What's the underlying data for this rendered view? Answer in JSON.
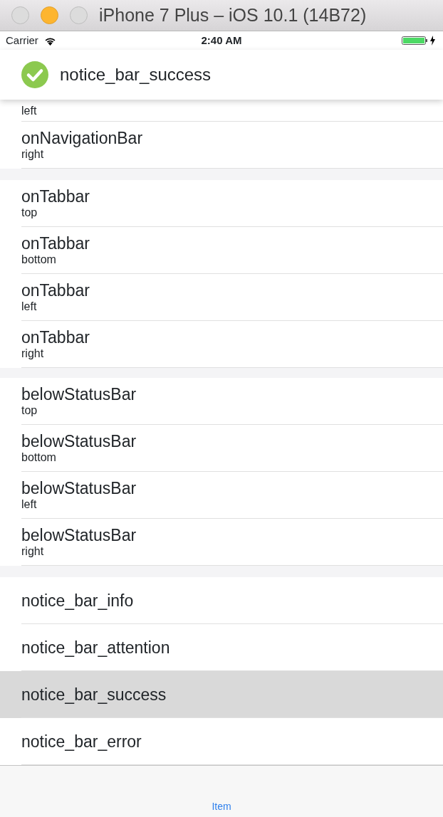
{
  "window": {
    "title": "iPhone 7 Plus – iOS 10.1 (14B72)"
  },
  "status_bar": {
    "carrier": "Carrier",
    "time": "2:40 AM"
  },
  "notice": {
    "kind": "success",
    "title": "notice_bar_success"
  },
  "sections": [
    {
      "rows": [
        {
          "subtitle": "left",
          "selected": false
        },
        {
          "title": "onNavigationBar",
          "subtitle": "right",
          "selected": false
        }
      ]
    },
    {
      "rows": [
        {
          "title": "onTabbar",
          "subtitle": "top",
          "selected": false
        },
        {
          "title": "onTabbar",
          "subtitle": "bottom",
          "selected": false
        },
        {
          "title": "onTabbar",
          "subtitle": "left",
          "selected": false
        },
        {
          "title": "onTabbar",
          "subtitle": "right",
          "selected": false
        }
      ]
    },
    {
      "rows": [
        {
          "title": "belowStatusBar",
          "subtitle": "top",
          "selected": false
        },
        {
          "title": "belowStatusBar",
          "subtitle": "bottom",
          "selected": false
        },
        {
          "title": "belowStatusBar",
          "subtitle": "left",
          "selected": false
        },
        {
          "title": "belowStatusBar",
          "subtitle": "right",
          "selected": false
        }
      ]
    },
    {
      "rows": [
        {
          "title": "notice_bar_info",
          "selected": false
        },
        {
          "title": "notice_bar_attention",
          "selected": false
        },
        {
          "title": "notice_bar_success",
          "selected": true
        },
        {
          "title": "notice_bar_error",
          "selected": false
        }
      ]
    }
  ],
  "tab_bar": {
    "items": [
      {
        "label": "Item",
        "selected": true
      }
    ]
  }
}
